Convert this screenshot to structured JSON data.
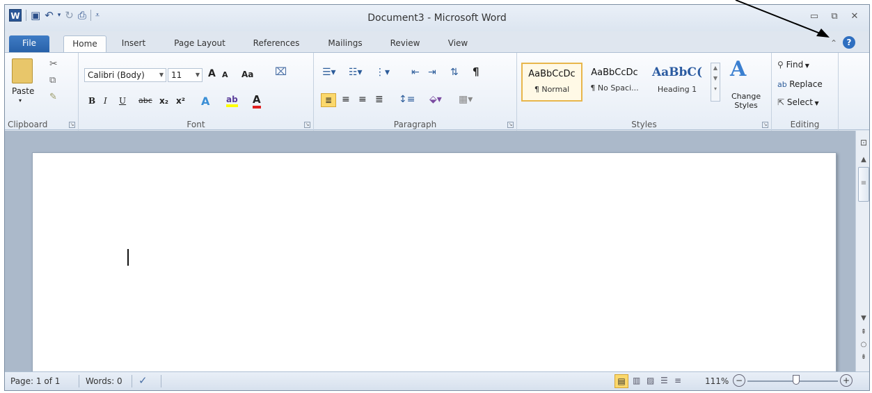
{
  "window": {
    "title": "Document3 - Microsoft Word"
  },
  "qat": {
    "logo": "W",
    "items": [
      "save-icon",
      "undo-icon",
      "redo-icon",
      "quick-print-icon",
      "customize-icon"
    ]
  },
  "tabs": [
    "File",
    "Home",
    "Insert",
    "Page Layout",
    "References",
    "Mailings",
    "Review",
    "View"
  ],
  "clipboard": {
    "label": "Clipboard",
    "paste": "Paste"
  },
  "font": {
    "label": "Font",
    "name": "Calibri (Body)",
    "size": "11",
    "change_case": "Aa",
    "bold": "B",
    "italic": "I",
    "underline": "U",
    "strike": "abc",
    "subscript": "x₂",
    "superscript": "x²",
    "grow": "A",
    "shrink": "A",
    "highlight": "ab",
    "font_color": "A",
    "effects": "A"
  },
  "paragraph": {
    "label": "Paragraph",
    "show_marks": "¶"
  },
  "styles": {
    "label": "Styles",
    "items": [
      {
        "sample": "AaBbCcDc",
        "name": "¶ Normal"
      },
      {
        "sample": "AaBbCcDc",
        "name": "¶ No Spaci..."
      },
      {
        "sample": "AaBbC(",
        "name": "Heading 1"
      }
    ],
    "change_styles": [
      "Change",
      "Styles"
    ]
  },
  "editing": {
    "label": "Editing",
    "find": "Find",
    "replace": "Replace",
    "select": "Select"
  },
  "status": {
    "page": "Page: 1 of 1",
    "words": "Words: 0",
    "zoom": "111%",
    "zoom_out": "−",
    "zoom_in": "+"
  },
  "colors": {
    "file_tab": "#2861a9",
    "doc_background": "#abb9ca",
    "highlight_yellow": "#ffff00",
    "font_color_red": "#e02020",
    "style_selected_border": "#e8b64b"
  }
}
